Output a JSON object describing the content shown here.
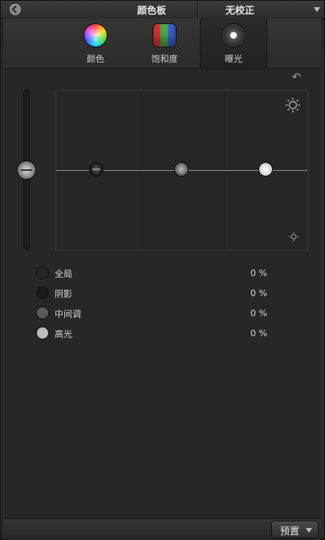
{
  "titlebar": {
    "title": "颜色板",
    "correction": "无校正"
  },
  "tabs": [
    {
      "label": "颜色",
      "icon": "color-wheel-icon"
    },
    {
      "label": "饱和度",
      "icon": "saturation-icon"
    },
    {
      "label": "曝光",
      "icon": "exposure-icon",
      "active": true
    }
  ],
  "controls": [
    {
      "label": "全局",
      "value": "0 %"
    },
    {
      "label": "阴影",
      "value": "0 %"
    },
    {
      "label": "中间调",
      "value": "0 %"
    },
    {
      "label": "高光",
      "value": "0 %"
    }
  ],
  "footer": {
    "preset_label": "预置"
  },
  "colors": {
    "panel_bg": "#272727",
    "text": "#d6d6d6"
  }
}
